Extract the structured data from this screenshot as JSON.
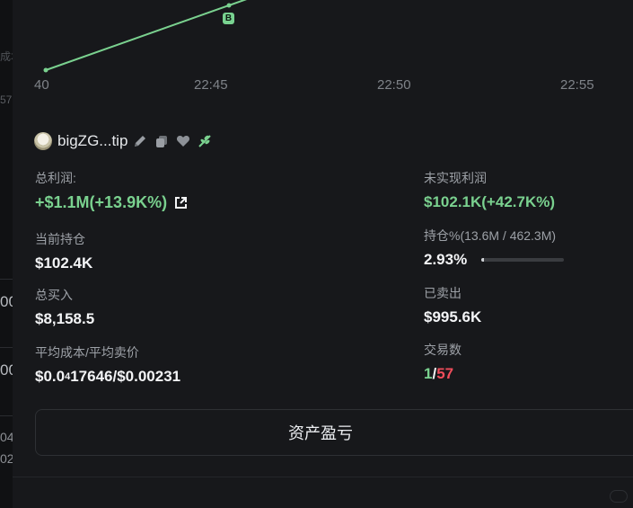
{
  "background_fragments": [
    "成本",
    "57",
    "00",
    "00",
    "04",
    "02"
  ],
  "chart": {
    "x_ticks": [
      "40",
      "22:45",
      "22:50",
      "22:55"
    ],
    "marker_label": "B",
    "line_color": "#7ad18f"
  },
  "user": {
    "name": "bigZG...tip",
    "icons": [
      "avatar-icon",
      "edit-icon",
      "copy-icon",
      "heart-icon",
      "leaf-icon"
    ]
  },
  "stats": {
    "total_profit": {
      "label": "总利润:",
      "value": "+$1.1M(+13.9K%)"
    },
    "unrealized_profit": {
      "label": "未实现利润",
      "value": "$102.1K(+42.7K%)"
    },
    "current_holding": {
      "label": "当前持仓",
      "value": "$102.4K"
    },
    "holding_pct": {
      "label": "持仓%(13.6M / 462.3M)",
      "value": "2.93%",
      "fill_fraction": 0.0293
    },
    "total_bought": {
      "label": "总买入",
      "value": "$8,158.5"
    },
    "sold": {
      "label": "已卖出",
      "value": "$995.6K"
    },
    "avg_cost": {
      "label": "平均成本/平均卖价",
      "value_prefix": "$0.0",
      "value_sub": "4",
      "value_rest": "17646/$0.00231"
    },
    "trades": {
      "label": "交易数",
      "buys": "1",
      "separator": "/",
      "sells": "57"
    }
  },
  "actions": {
    "asset_pnl": "资产盈亏"
  },
  "colors": {
    "positive": "#7ad18f",
    "negative": "#f04d5b",
    "panel": "#17181b"
  }
}
